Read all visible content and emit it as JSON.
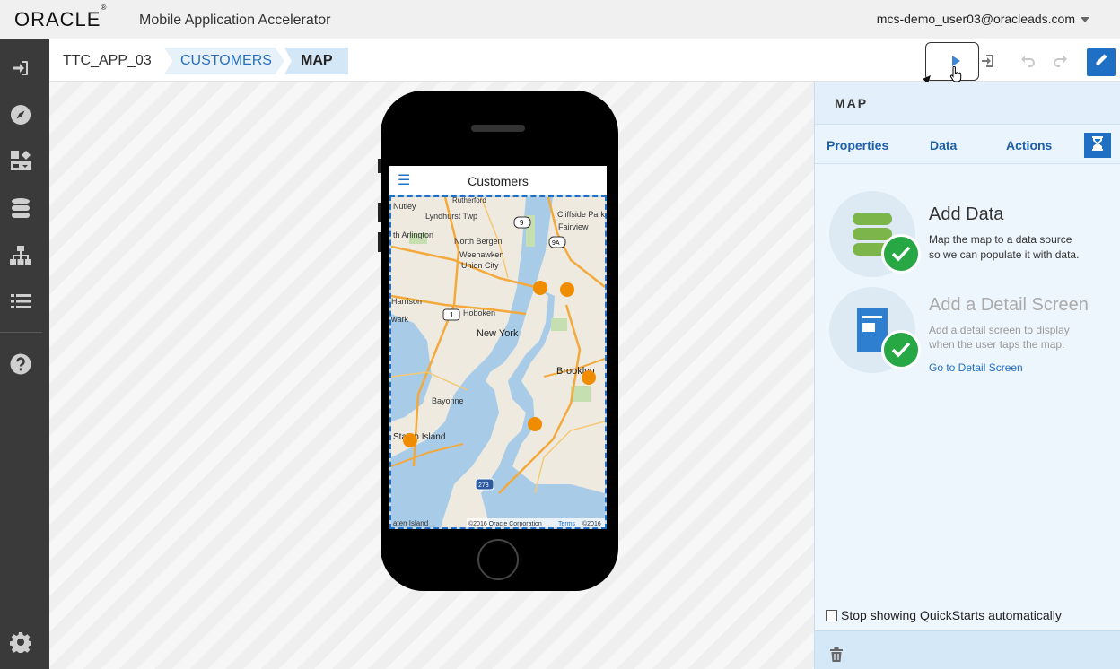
{
  "header": {
    "brand": "ORACLE",
    "brand_mark": "®",
    "app_title": "Mobile Application Accelerator",
    "user": "mcs-demo_user03@oracleads.com"
  },
  "rail": {
    "items": [
      {
        "icon": "sign-in-icon"
      },
      {
        "icon": "compass-icon"
      },
      {
        "icon": "layout-icon"
      },
      {
        "icon": "database-icon"
      },
      {
        "icon": "sitemap-icon"
      },
      {
        "icon": "list-icon"
      },
      {
        "icon": "help-icon"
      },
      {
        "icon": "gear-icon"
      }
    ]
  },
  "breadcrumb": {
    "root": "TTC_APP_03",
    "items": [
      "CUSTOMERS",
      "MAP"
    ]
  },
  "toolbar": {
    "icons": [
      "play-icon",
      "export-icon",
      "undo-icon",
      "redo-icon",
      "pencil-icon"
    ]
  },
  "phone": {
    "screen_title": "Customers",
    "map_labels": {
      "nutley": "Nutley",
      "lyndhurst": "Lyndhurst Twp",
      "rutherford": "Rutherford",
      "cliffside": "Cliffside Park",
      "fairview": "Fairview",
      "arlington": "th Arlington",
      "north_bergen": "North Bergen",
      "weehawken": "Weehawken",
      "union_city": "Union City",
      "harrison": "Harrison",
      "hoboken": "Hoboken",
      "newark": "wark",
      "new_york": "New York",
      "brooklyn": "Brooklyn",
      "bayonne": "Bayonne",
      "staten_island": "Staten Island",
      "staten_island_bottom": "aten Island",
      "route_9": "9",
      "route_9a": "9A",
      "route_1": "1",
      "route_278": "278",
      "copyright": "©2016 Oracle Corporation",
      "terms": "Terms",
      "copyright_year": "©2016"
    }
  },
  "panel": {
    "title": "MAP",
    "tabs": [
      "Properties",
      "Data",
      "Actions"
    ],
    "add_data": {
      "heading": "Add Data",
      "desc_line1": "Map the map to a data source",
      "desc_line2": "so we can populate it with data."
    },
    "detail": {
      "heading": "Add a Detail Screen",
      "desc_line1": "Add a detail screen to display",
      "desc_line2": "when the user taps the map.",
      "link": "Go to Detail Screen"
    },
    "stop_label": "Stop showing QuickStarts automatically"
  },
  "colors": {
    "accent": "#1f6fc5",
    "rail": "#3a3a3a",
    "success": "#28a745",
    "marker": "#f08c00"
  }
}
